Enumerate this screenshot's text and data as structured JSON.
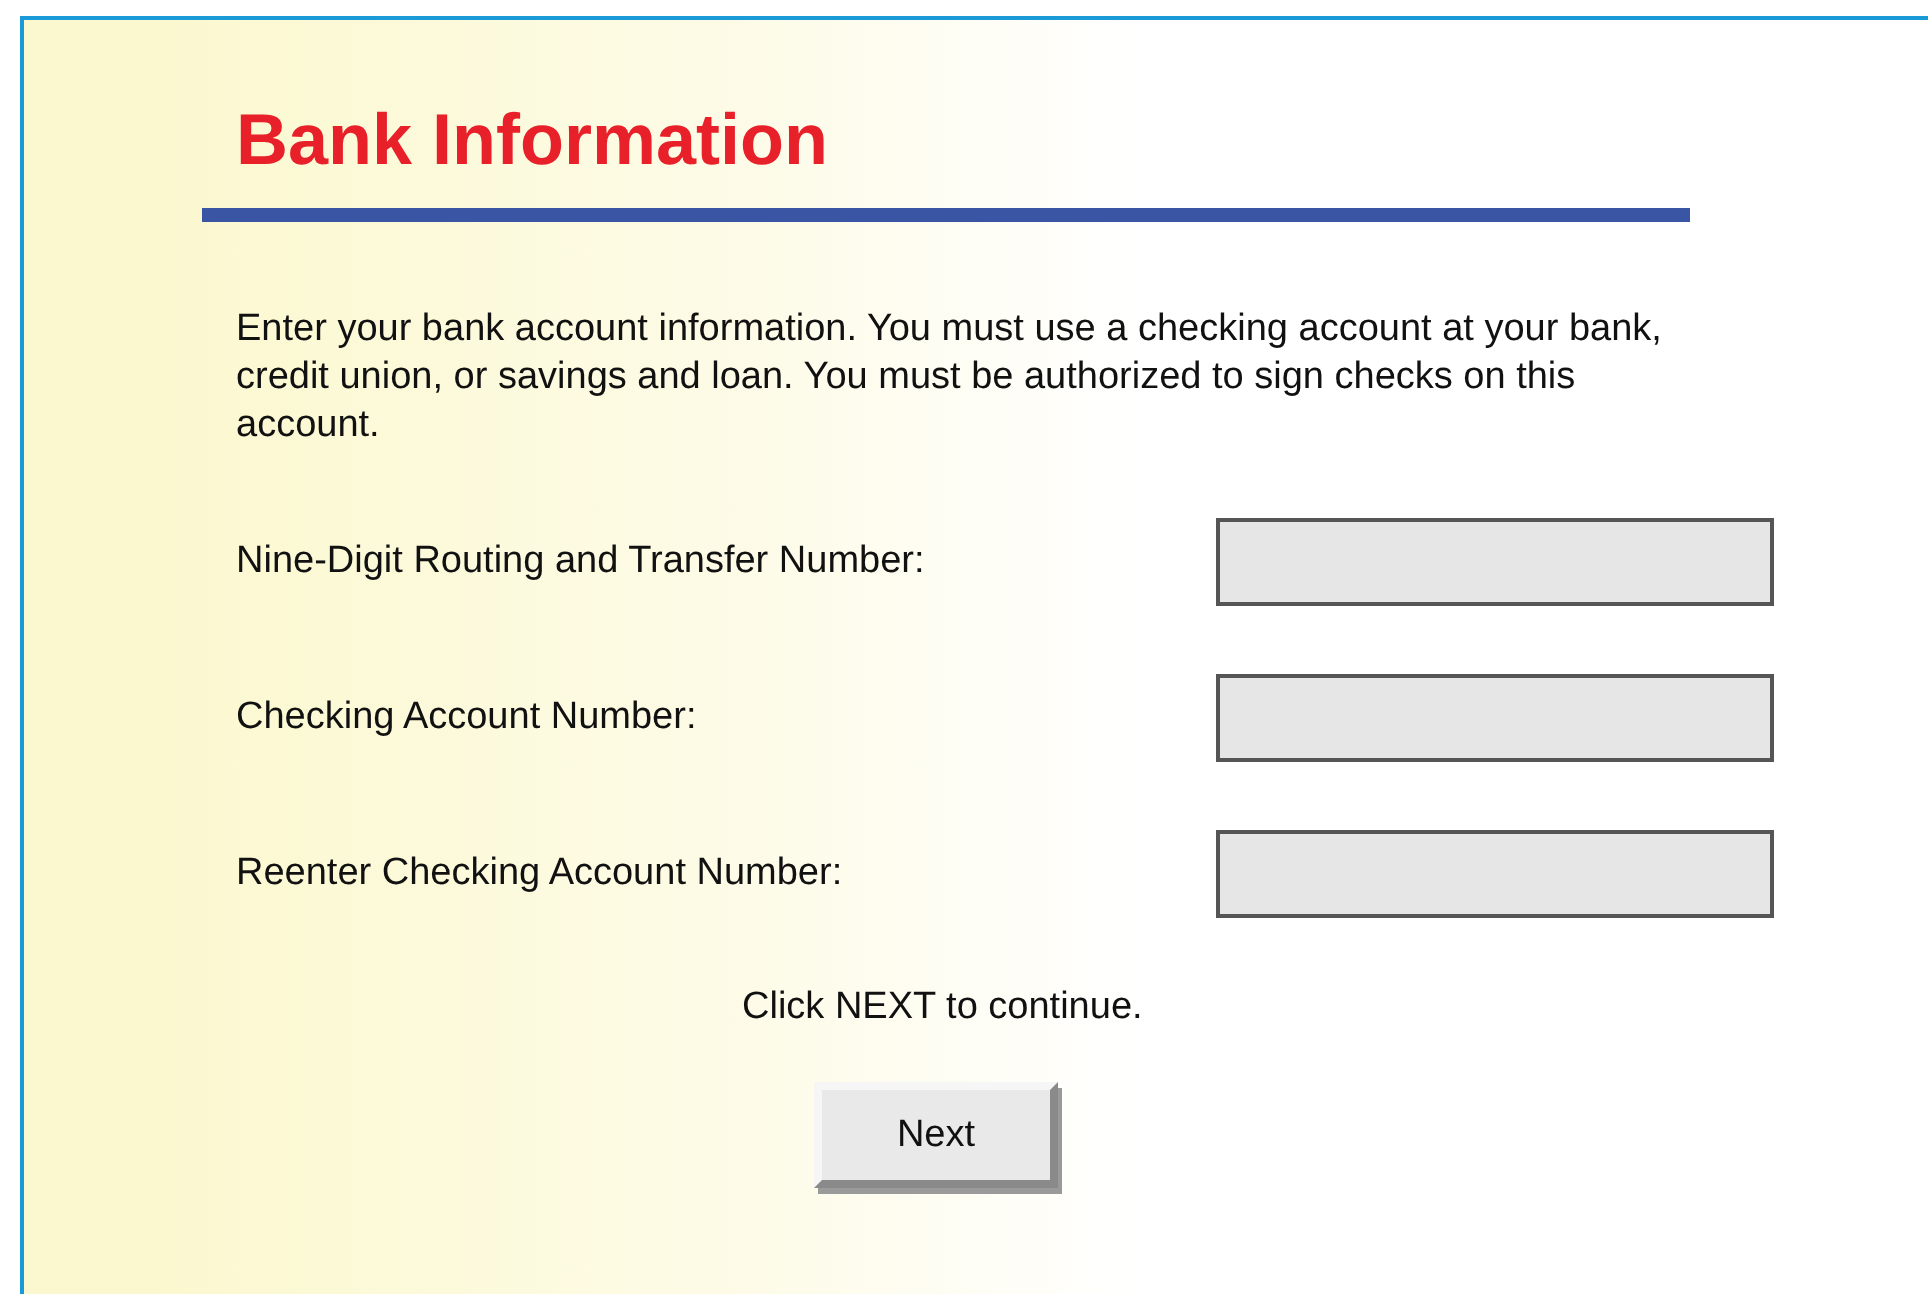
{
  "title": "Bank Information",
  "intro": "Enter your bank account information. You must use a checking account at your bank, credit union, or savings and loan. You must be authorized to sign checks on this account.",
  "fields": [
    {
      "label": "Nine-Digit Routing and Transfer Number:"
    },
    {
      "label": "Checking Account Number:"
    },
    {
      "label": "Reenter Checking Account Number:"
    }
  ],
  "hint": "Click NEXT to continue.",
  "button": "Next"
}
